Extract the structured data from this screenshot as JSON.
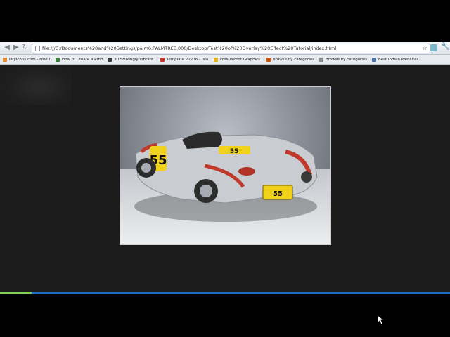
{
  "browser": {
    "url": "file:///C:/Documents%20and%20Settings/palm6.PALMTREE.000/Desktop/Test%20of%20Overlay%20Effect%20Tutorial/index.html",
    "nav_back": "◀",
    "nav_forward": "▶",
    "nav_reload": "↻",
    "star": "☆",
    "wrench": "🔧"
  },
  "bookmarks": [
    {
      "label": "DryIcons.com - Free I...",
      "icon_color": "#e08a2a"
    },
    {
      "label": "How to Create a Ribb...",
      "icon_color": "#3a7d3a"
    },
    {
      "label": "30 Strikingly Vibrant ...",
      "icon_color": "#3c3c3c"
    },
    {
      "label": "Template 22276 - Isla...",
      "icon_color": "#c0392b"
    },
    {
      "label": "Free Vector Graphics ...",
      "icon_color": "#e0b020"
    },
    {
      "label": "Browse by categories ...",
      "icon_color": "#d35400"
    },
    {
      "label": "Browse by categories...",
      "icon_color": "#8a8a8a"
    },
    {
      "label": "Best Indian Websites...",
      "icon_color": "#4a6fa5"
    }
  ],
  "photo": {
    "subject": "silver race car numbered 55",
    "number": "55",
    "plate": "55"
  },
  "progress_fraction": 0.07,
  "colors": {
    "page_background": "#1b1b1b",
    "accent_blue": "#1a73c8",
    "progress_green": "#7ecf4f"
  }
}
